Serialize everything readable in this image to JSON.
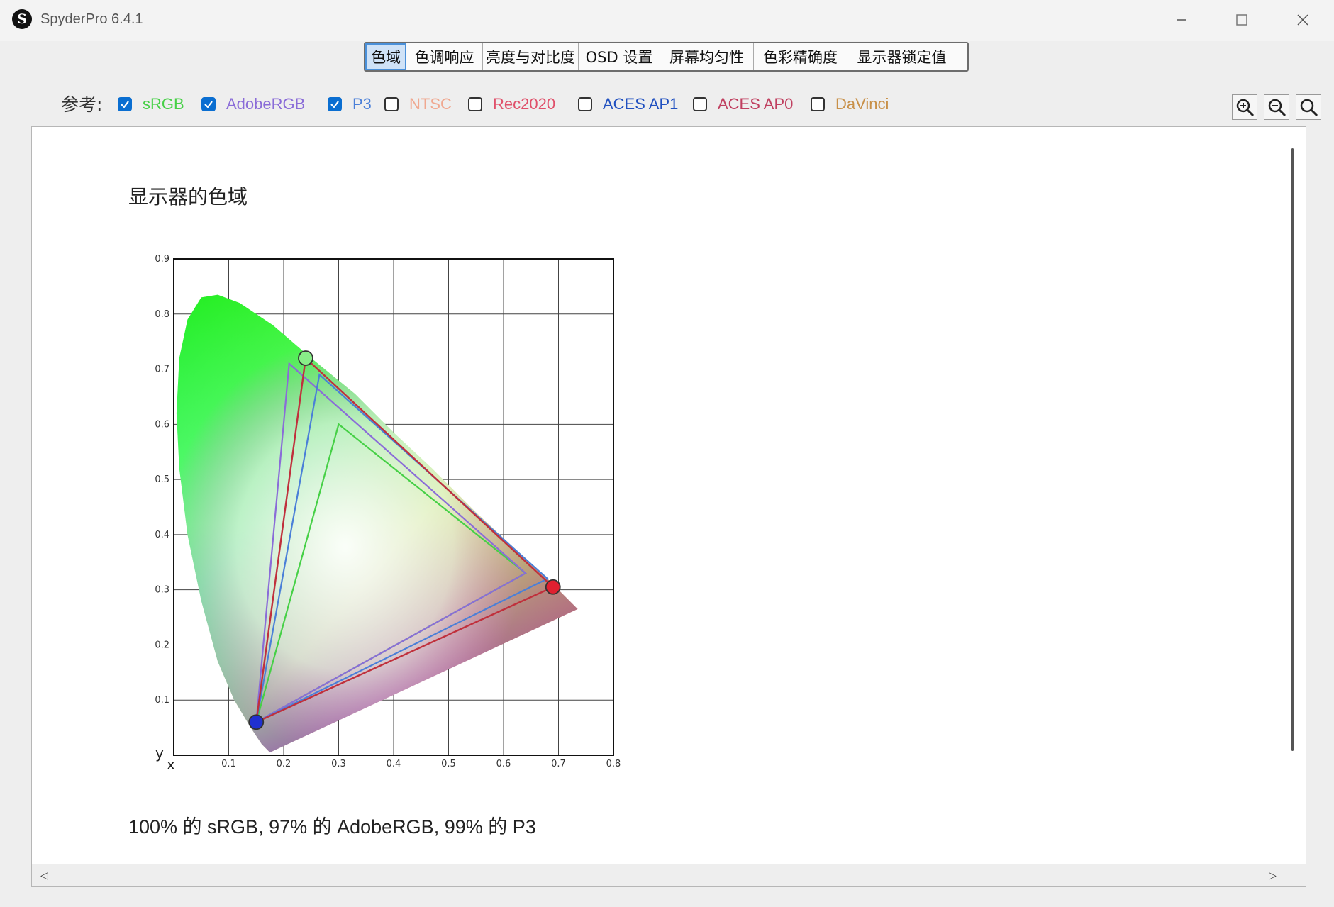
{
  "app": {
    "title": "SpyderPro 6.4.1",
    "icon_letter": "S"
  },
  "tabs": [
    {
      "label": "色域",
      "active": true
    },
    {
      "label": "色调响应",
      "active": false
    },
    {
      "label": "亮度与对比度",
      "active": false
    },
    {
      "label": "OSD 设置",
      "active": false
    },
    {
      "label": "屏幕均匀性",
      "active": false
    },
    {
      "label": "色彩精确度",
      "active": false
    },
    {
      "label": "显示器锁定值",
      "active": false
    }
  ],
  "reference": {
    "label": "参考:",
    "items": [
      {
        "label": "sRGB",
        "checked": true,
        "color": "#46d046"
      },
      {
        "label": "AdobeRGB",
        "checked": true,
        "color": "#8a6cd8"
      },
      {
        "label": "P3",
        "checked": true,
        "color": "#4a7fd8"
      },
      {
        "label": "NTSC",
        "checked": false,
        "color": "#f0a890"
      },
      {
        "label": "Rec2020",
        "checked": false,
        "color": "#e0506a"
      },
      {
        "label": "ACES AP1",
        "checked": false,
        "color": "#2050c0"
      },
      {
        "label": "ACES AP0",
        "checked": false,
        "color": "#c04060"
      },
      {
        "label": "DaVinci",
        "checked": false,
        "color": "#c89048"
      }
    ]
  },
  "zoom": {
    "icons": [
      "zoom-in-icon",
      "zoom-out-icon",
      "zoom-fit-icon"
    ]
  },
  "main": {
    "gamut_title": "显示器的色域",
    "summary": "100% 的 sRGB, 97% 的 AdobeRGB, 99% 的 P3"
  },
  "chart_data": {
    "type": "scatter",
    "title": "",
    "xlabel": "x",
    "ylabel": "y",
    "xlim": [
      0.0,
      0.8
    ],
    "ylim": [
      0.0,
      0.9
    ],
    "x_ticks": [
      "0.1",
      "0.2",
      "0.3",
      "0.4",
      "0.5",
      "0.6",
      "0.7",
      "0.8"
    ],
    "y_ticks": [
      "0.1",
      "0.2",
      "0.3",
      "0.4",
      "0.5",
      "0.6",
      "0.7",
      "0.8",
      "0.9"
    ],
    "grid": true,
    "series": [
      {
        "name": "sRGB",
        "color": "#46d046",
        "points": [
          [
            0.64,
            0.33
          ],
          [
            0.3,
            0.6
          ],
          [
            0.15,
            0.06
          ]
        ]
      },
      {
        "name": "AdobeRGB",
        "color": "#8a6cd8",
        "points": [
          [
            0.64,
            0.33
          ],
          [
            0.21,
            0.71
          ],
          [
            0.15,
            0.06
          ]
        ]
      },
      {
        "name": "P3",
        "color": "#4a7fd8",
        "points": [
          [
            0.68,
            0.32
          ],
          [
            0.265,
            0.69
          ],
          [
            0.15,
            0.06
          ]
        ]
      }
    ],
    "display_gamut": {
      "color": "#c0303c",
      "points": [
        [
          0.69,
          0.305
        ],
        [
          0.24,
          0.72
        ],
        [
          0.15,
          0.06
        ]
      ]
    }
  }
}
